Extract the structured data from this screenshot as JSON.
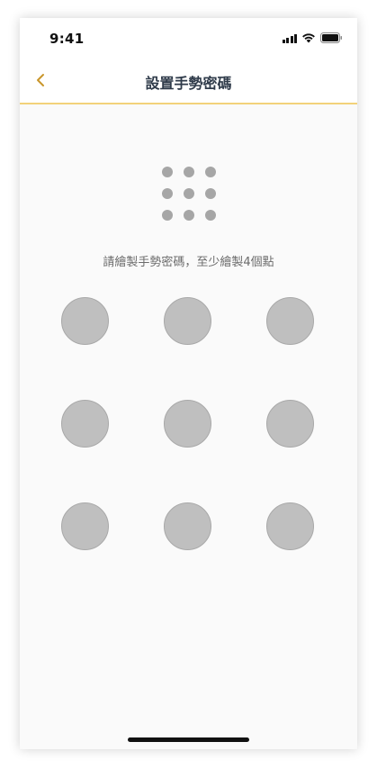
{
  "status_bar": {
    "time": "9:41",
    "icons": [
      "cellular-signal-icon",
      "wifi-icon",
      "battery-icon"
    ]
  },
  "nav": {
    "back_icon": "chevron-left-icon",
    "title": "設置手勢密碼"
  },
  "preview": {
    "icon": "pattern-preview-grid-icon",
    "dots": 9
  },
  "hint": "請繪製手勢密碼，至少繪製4個點",
  "pattern": {
    "nodes": 9,
    "selected": []
  },
  "colors": {
    "accent": "#f2d27a",
    "back_chevron": "#c9962b",
    "title_text": "#2f3b4a",
    "node_fill": "#bfbfbf",
    "preview_dot": "#a6a6a6"
  }
}
